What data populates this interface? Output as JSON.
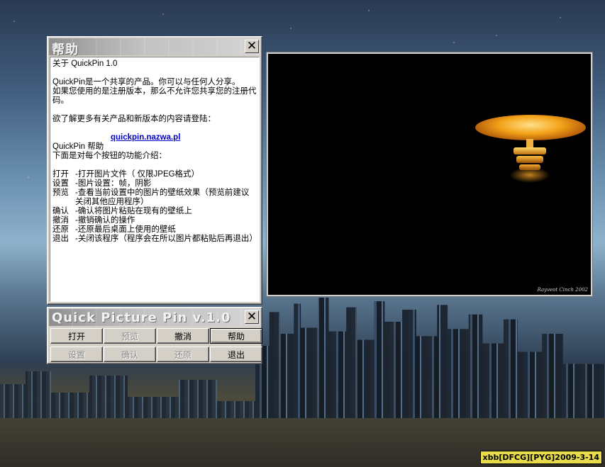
{
  "help_window": {
    "title": "帮助",
    "close_icon": "close-icon",
    "lines": {
      "about": "关于 QuickPin 1.0",
      "share1": "QuickPin是一个共享的产品。你可以与任何人分享。",
      "share2": "如果您使用的是注册版本，那么不允许您共享您的注册代码。",
      "more_info": "欲了解更多有关产品和新版本的内容请登陆：",
      "link": "quickpin.nazwa.pl",
      "help_heading": "QuickPin 帮助",
      "intro": "下面是对每个按钮的功能介绍："
    },
    "functions": [
      {
        "key": "打开",
        "desc": "-打开图片文件（ 仅限JPEG格式）"
      },
      {
        "key": "设置",
        "desc": "-图片设置：帧，阴影"
      },
      {
        "key": "预览",
        "desc": "-查看当前设置中的图片的壁纸效果（预览前建议关闭其他应用程序）"
      },
      {
        "key": "确认",
        "desc": "-确认将图片粘贴在现有的壁纸上"
      },
      {
        "key": "撤消",
        "desc": "-撤销确认的操作"
      },
      {
        "key": "还原",
        "desc": "-还原最后桌面上使用的壁纸"
      },
      {
        "key": "退出",
        "desc": "-关闭该程序（程序会在所以图片都粘贴后再退出）"
      }
    ]
  },
  "preview_window": {
    "image": "lamp-picture",
    "signature": "Rayveot Cinch 2002"
  },
  "main_window": {
    "title": "Quick Picture Pin v.1.0",
    "buttons_row1": [
      {
        "label": "打开",
        "enabled": true
      },
      {
        "label": "预览",
        "enabled": false
      },
      {
        "label": "撤消",
        "enabled": true
      },
      {
        "label": "帮助",
        "enabled": true
      }
    ],
    "buttons_row2": [
      {
        "label": "设置",
        "enabled": false
      },
      {
        "label": "确认",
        "enabled": false
      },
      {
        "label": "还原",
        "enabled": false
      },
      {
        "label": "退出",
        "enabled": true
      }
    ]
  },
  "watermark": "xbb[DFCG][PYG]2009-3-14",
  "colors": {
    "window_face": "#d4d0c8",
    "link": "#0000cc",
    "watermark_bg": "#e8dc4a"
  }
}
